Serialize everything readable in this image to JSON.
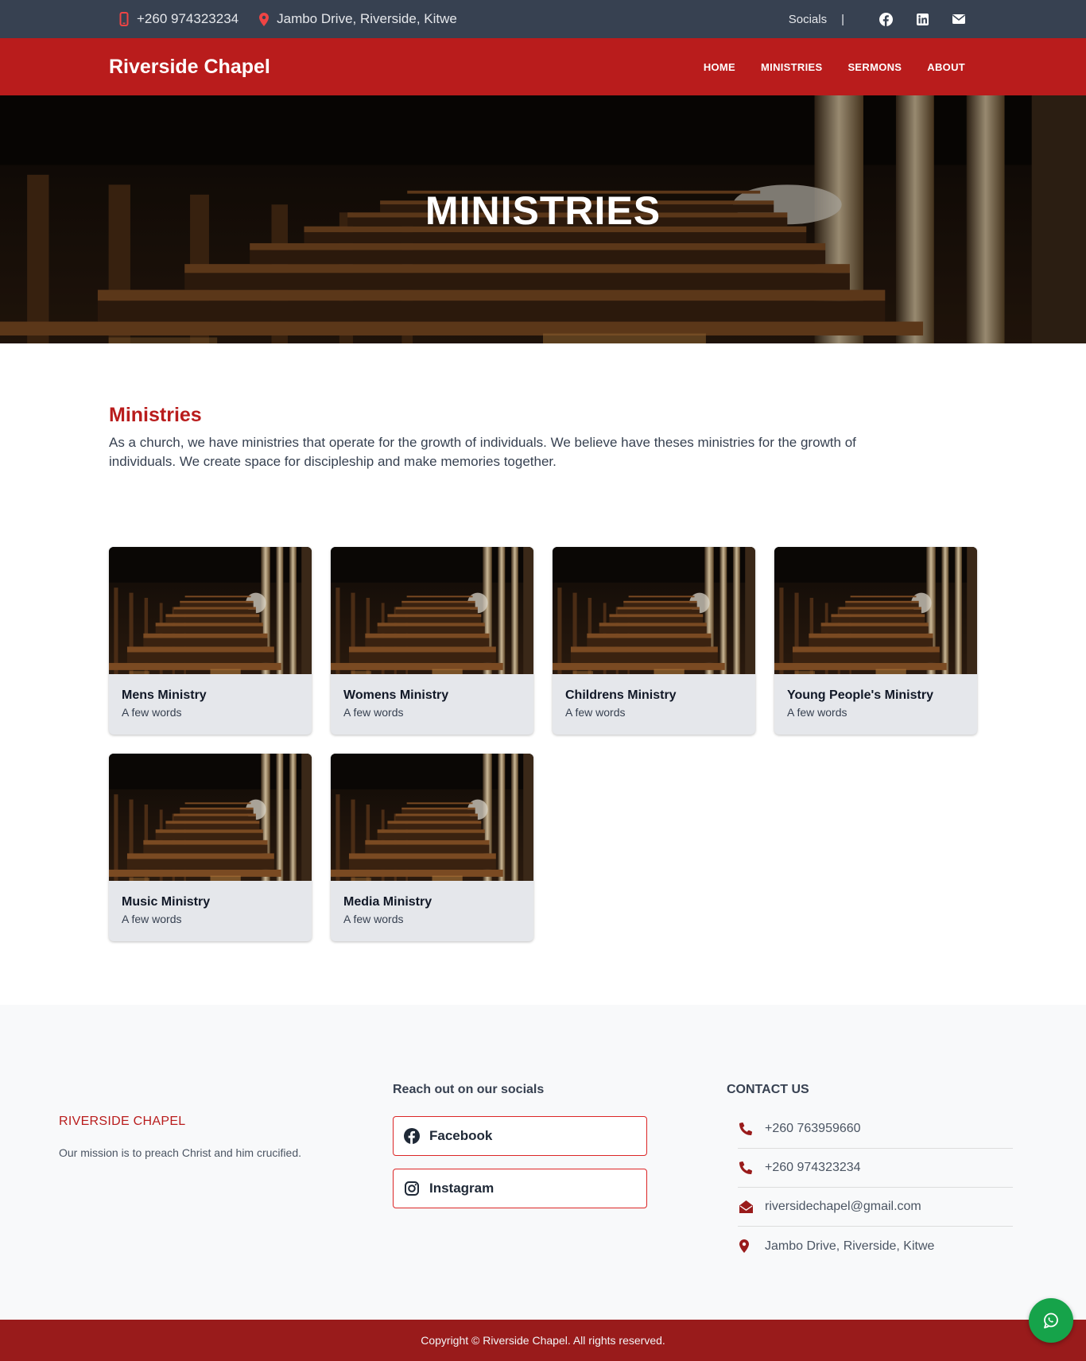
{
  "topbar": {
    "phone": "+260 974323234",
    "address": "Jambo Drive, Riverside, Kitwe",
    "socials_label": "Socials",
    "separator": "|",
    "icons": [
      "phone-icon",
      "map-pin-icon",
      "facebook-icon",
      "linkedin-icon",
      "envelope-icon"
    ]
  },
  "navbar": {
    "brand": "Riverside Chapel",
    "links": [
      "HOME",
      "MINISTRIES",
      "SERMONS",
      "ABOUT"
    ]
  },
  "hero": {
    "title": "MINISTRIES"
  },
  "intro": {
    "heading": "Ministries",
    "text": "As a church, we have ministries that operate for the growth of individuals. We believe have theses ministries for the growth of individuals. We create space for discipleship and make memories together."
  },
  "ministries": [
    {
      "title": "Mens Ministry",
      "subtitle": "A few words"
    },
    {
      "title": "Womens Ministry",
      "subtitle": "A few words"
    },
    {
      "title": "Childrens Ministry",
      "subtitle": "A few words"
    },
    {
      "title": "Young People's Ministry",
      "subtitle": "A few words"
    },
    {
      "title": "Music Ministry",
      "subtitle": "A few words"
    },
    {
      "title": "Media Ministry",
      "subtitle": "A few words"
    }
  ],
  "footer": {
    "brand": "RIVERSIDE CHAPEL",
    "mission": "Our mission is to preach Christ and him crucified.",
    "socials_heading": "Reach out on our socials",
    "social_buttons": [
      "Facebook",
      "Instagram"
    ],
    "contact_heading": "CONTACT US",
    "contacts": [
      {
        "icon": "phone-icon",
        "text": "+260 763959660"
      },
      {
        "icon": "phone-icon",
        "text": "+260 974323234"
      },
      {
        "icon": "envelope-open-icon",
        "text": "riversidechapel@gmail.com"
      },
      {
        "icon": "map-pin-icon",
        "text": "Jambo Drive, Riverside, Kitwe"
      }
    ],
    "copyright": "Copyright © Riverside Chapel. All rights reserved."
  },
  "colors": {
    "topbar": "#374151",
    "brand_red": "#b91c1c",
    "footer_bar": "#991b1b",
    "whatsapp": "#16a34a"
  }
}
